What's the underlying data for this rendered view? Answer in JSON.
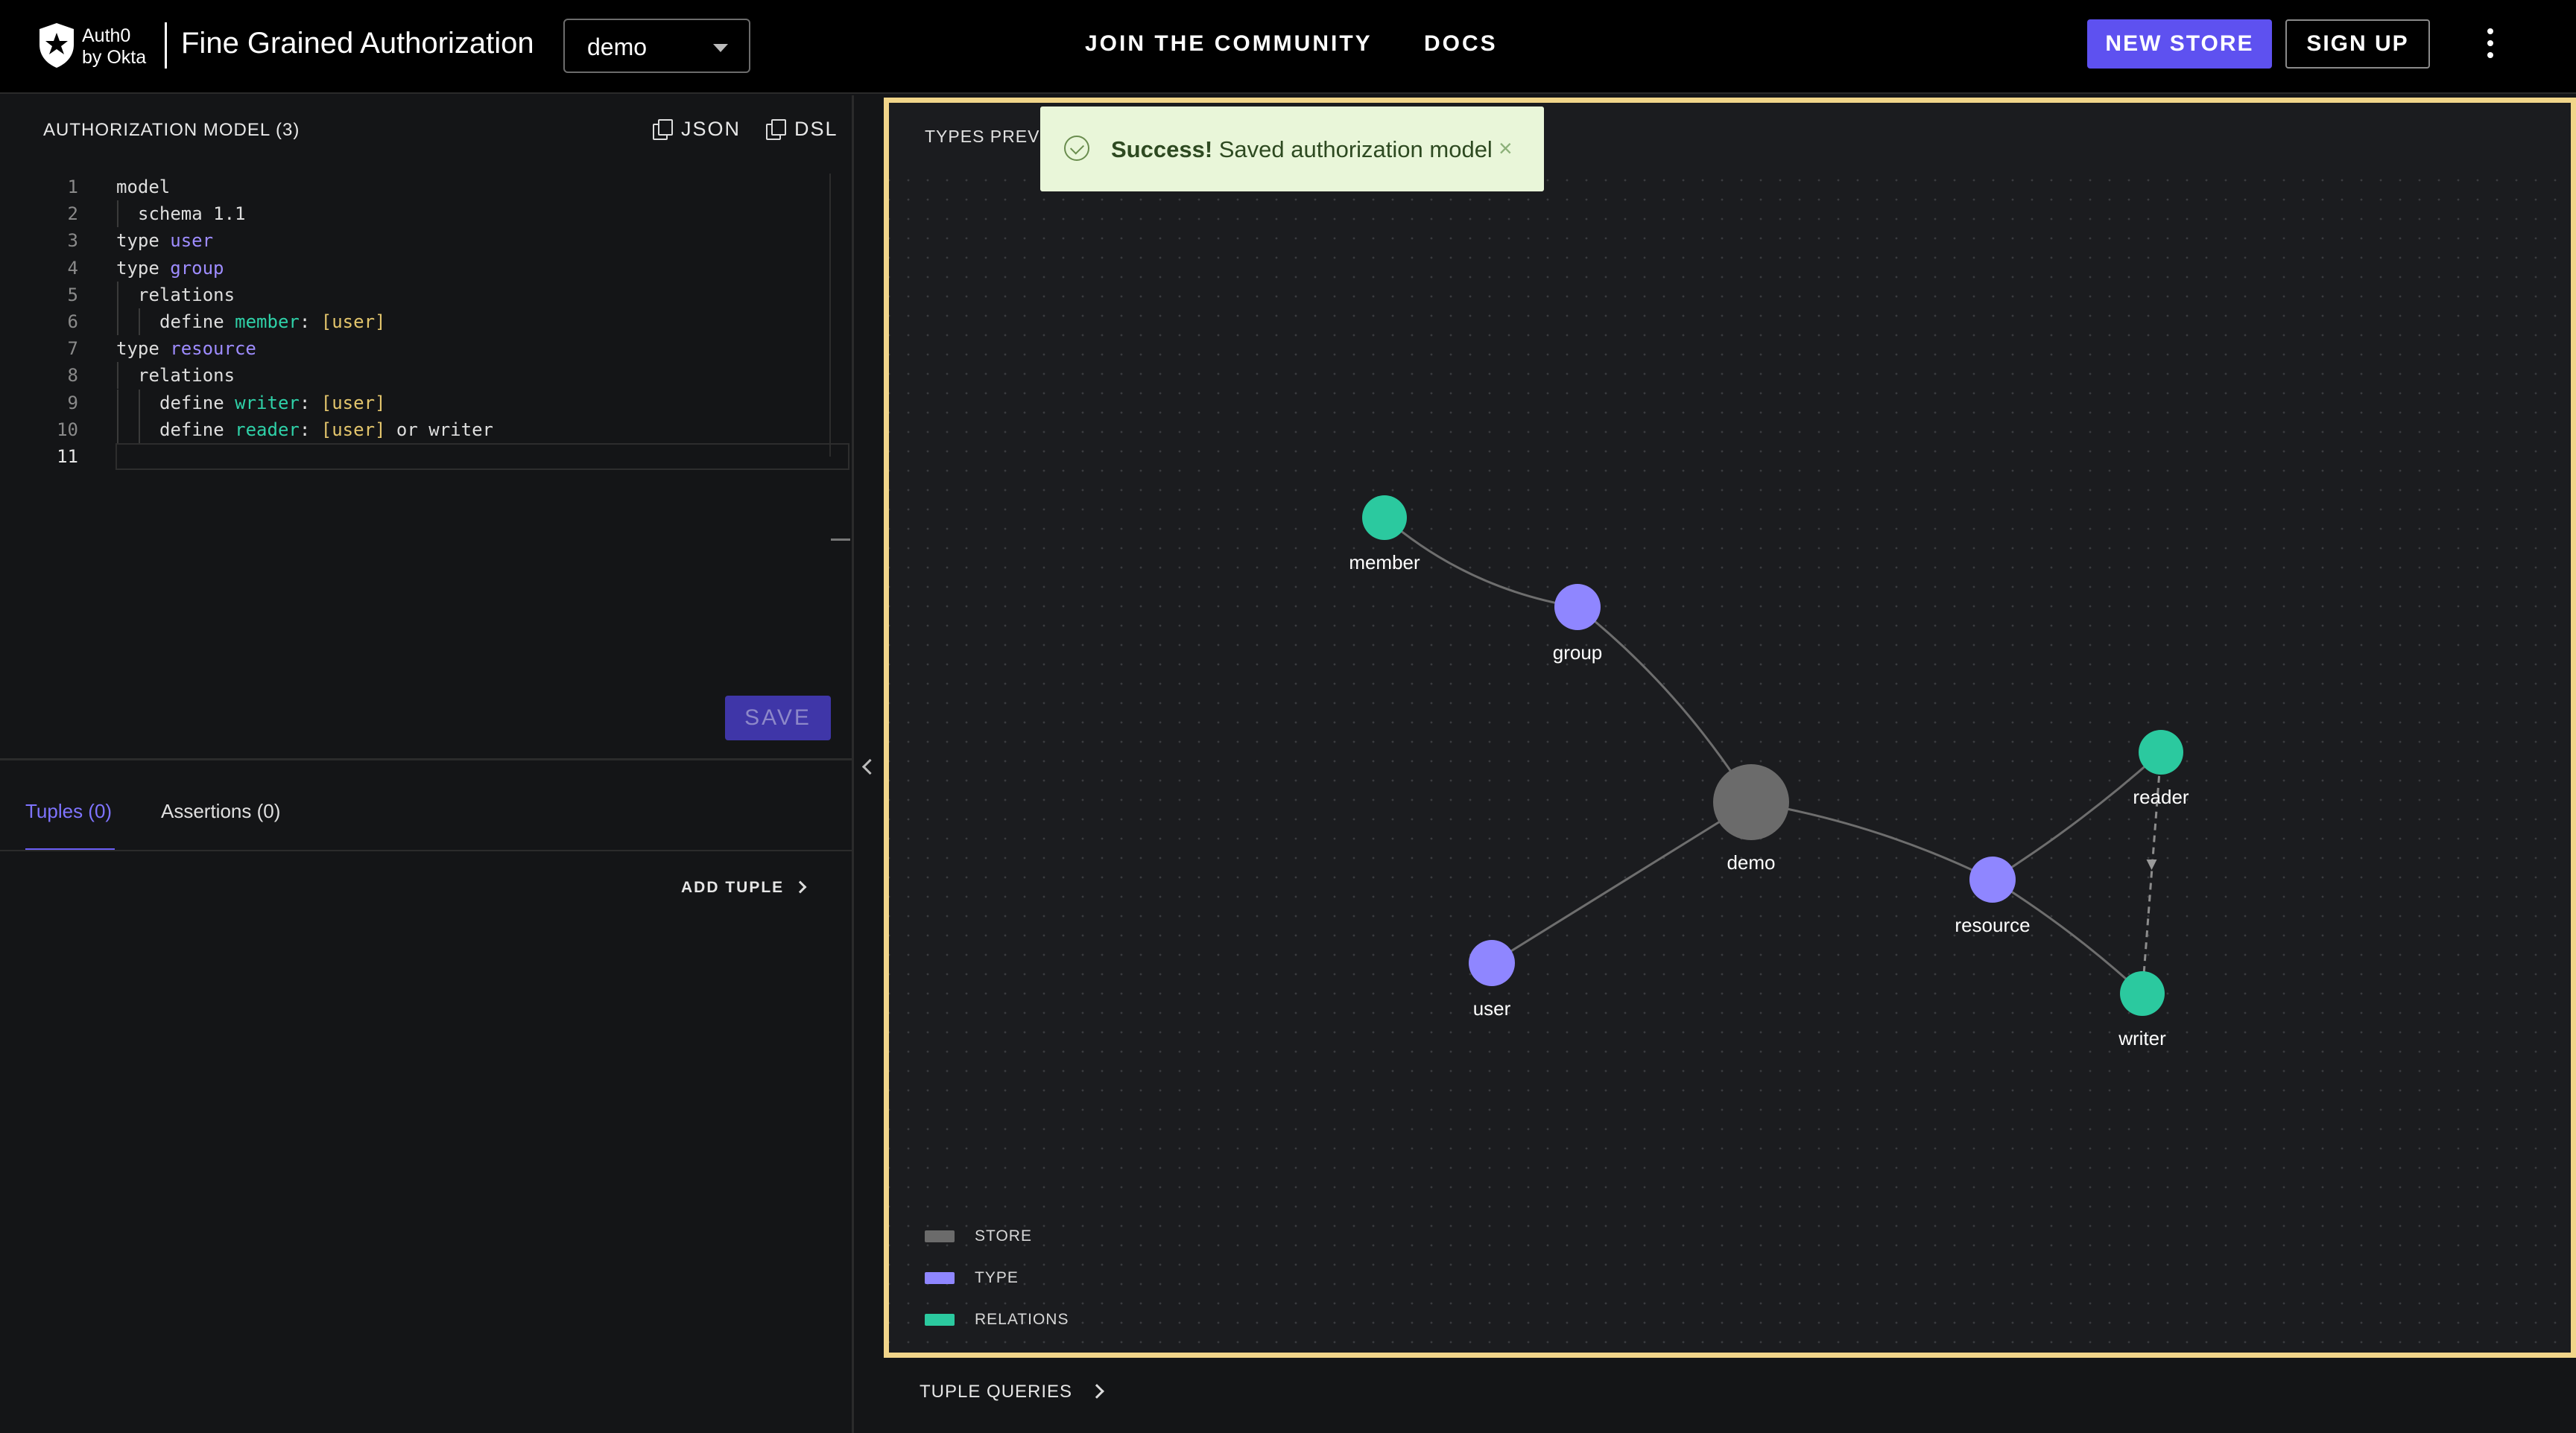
{
  "header": {
    "logo_text_line1": "Auth0",
    "logo_text_line2": "by Okta",
    "product_name": "Fine Grained Authorization",
    "store_selected": "demo",
    "nav": [
      {
        "label": "JOIN  THE COMMUNITY"
      },
      {
        "label": "DOCS"
      }
    ],
    "new_store_label": "NEW STORE",
    "signup_label": "SIGN UP",
    "colors": {
      "accent": "#5e51f0",
      "background": "#000000"
    }
  },
  "model_panel": {
    "title": "AUTHORIZATION MODEL (3)",
    "json_label": "JSON",
    "dsl_label": "DSL",
    "save_label": "SAVE",
    "code_lines": [
      {
        "n": "1",
        "parts": [
          {
            "t": "model",
            "c": "plain"
          }
        ]
      },
      {
        "n": "2",
        "parts": [
          {
            "t": "schema ",
            "c": "plain"
          },
          {
            "t": "1.1",
            "c": "plain"
          }
        ]
      },
      {
        "n": "3",
        "parts": [
          {
            "t": "type ",
            "c": "plain"
          },
          {
            "t": "user",
            "c": "type"
          }
        ]
      },
      {
        "n": "4",
        "parts": [
          {
            "t": "type ",
            "c": "plain"
          },
          {
            "t": "group",
            "c": "type"
          }
        ]
      },
      {
        "n": "5",
        "parts": [
          {
            "t": "relations",
            "c": "plain"
          }
        ]
      },
      {
        "n": "6",
        "parts": [
          {
            "t": "define ",
            "c": "plain"
          },
          {
            "t": "member",
            "c": "rel"
          },
          {
            "t": ": ",
            "c": "plain"
          },
          {
            "t": "[user]",
            "c": "bracket"
          }
        ]
      },
      {
        "n": "7",
        "parts": [
          {
            "t": "type ",
            "c": "plain"
          },
          {
            "t": "resource",
            "c": "type"
          }
        ]
      },
      {
        "n": "8",
        "parts": [
          {
            "t": "relations",
            "c": "plain"
          }
        ]
      },
      {
        "n": "9",
        "parts": [
          {
            "t": "define ",
            "c": "plain"
          },
          {
            "t": "writer",
            "c": "rel"
          },
          {
            "t": ": ",
            "c": "plain"
          },
          {
            "t": "[user]",
            "c": "bracket"
          }
        ]
      },
      {
        "n": "10",
        "parts": [
          {
            "t": "define ",
            "c": "plain"
          },
          {
            "t": "reader",
            "c": "rel"
          },
          {
            "t": ": ",
            "c": "plain"
          },
          {
            "t": "[user]",
            "c": "bracket"
          },
          {
            "t": " or writer",
            "c": "plain"
          }
        ]
      },
      {
        "n": "11",
        "parts": []
      }
    ],
    "code_colors": {
      "type": "#9e8cff",
      "relation": "#2fd1a8",
      "bracket": "#e3c56c"
    }
  },
  "tabs": [
    {
      "label": "Tuples (0)",
      "active": true
    },
    {
      "label": "Assertions (0)",
      "active": false
    }
  ],
  "add_tuple_label": "ADD TUPLE",
  "preview": {
    "title": "TYPES PREVIEW",
    "toast_strong": "Success!",
    "toast_text": " Saved authorization model",
    "toast_close": "×",
    "nodes": [
      {
        "id": "member",
        "label": "member",
        "kind": "relation"
      },
      {
        "id": "group",
        "label": "group",
        "kind": "type"
      },
      {
        "id": "demo",
        "label": "demo",
        "kind": "store"
      },
      {
        "id": "user",
        "label": "user",
        "kind": "type"
      },
      {
        "id": "resource",
        "label": "resource",
        "kind": "type"
      },
      {
        "id": "reader",
        "label": "reader",
        "kind": "relation"
      },
      {
        "id": "writer",
        "label": "writer",
        "kind": "relation"
      }
    ],
    "edges": [
      {
        "from": "member",
        "to": "group",
        "style": "solid"
      },
      {
        "from": "group",
        "to": "demo",
        "style": "solid"
      },
      {
        "from": "demo",
        "to": "user",
        "style": "solid"
      },
      {
        "from": "demo",
        "to": "resource",
        "style": "solid"
      },
      {
        "from": "resource",
        "to": "reader",
        "style": "solid"
      },
      {
        "from": "resource",
        "to": "writer",
        "style": "solid"
      },
      {
        "from": "reader",
        "to": "writer",
        "style": "dashed"
      }
    ],
    "legend": [
      {
        "label": "STORE",
        "color": "#6b6b6b"
      },
      {
        "label": "TYPE",
        "color": "#8f86ff"
      },
      {
        "label": "RELATIONS",
        "color": "#2bc99f"
      }
    ],
    "colors": {
      "store": "#6b6b6b",
      "type": "#8f86ff",
      "relation": "#2bc99f",
      "highlight_border": "#f1d58a"
    }
  },
  "tuple_queries_label": "TUPLE QUERIES"
}
